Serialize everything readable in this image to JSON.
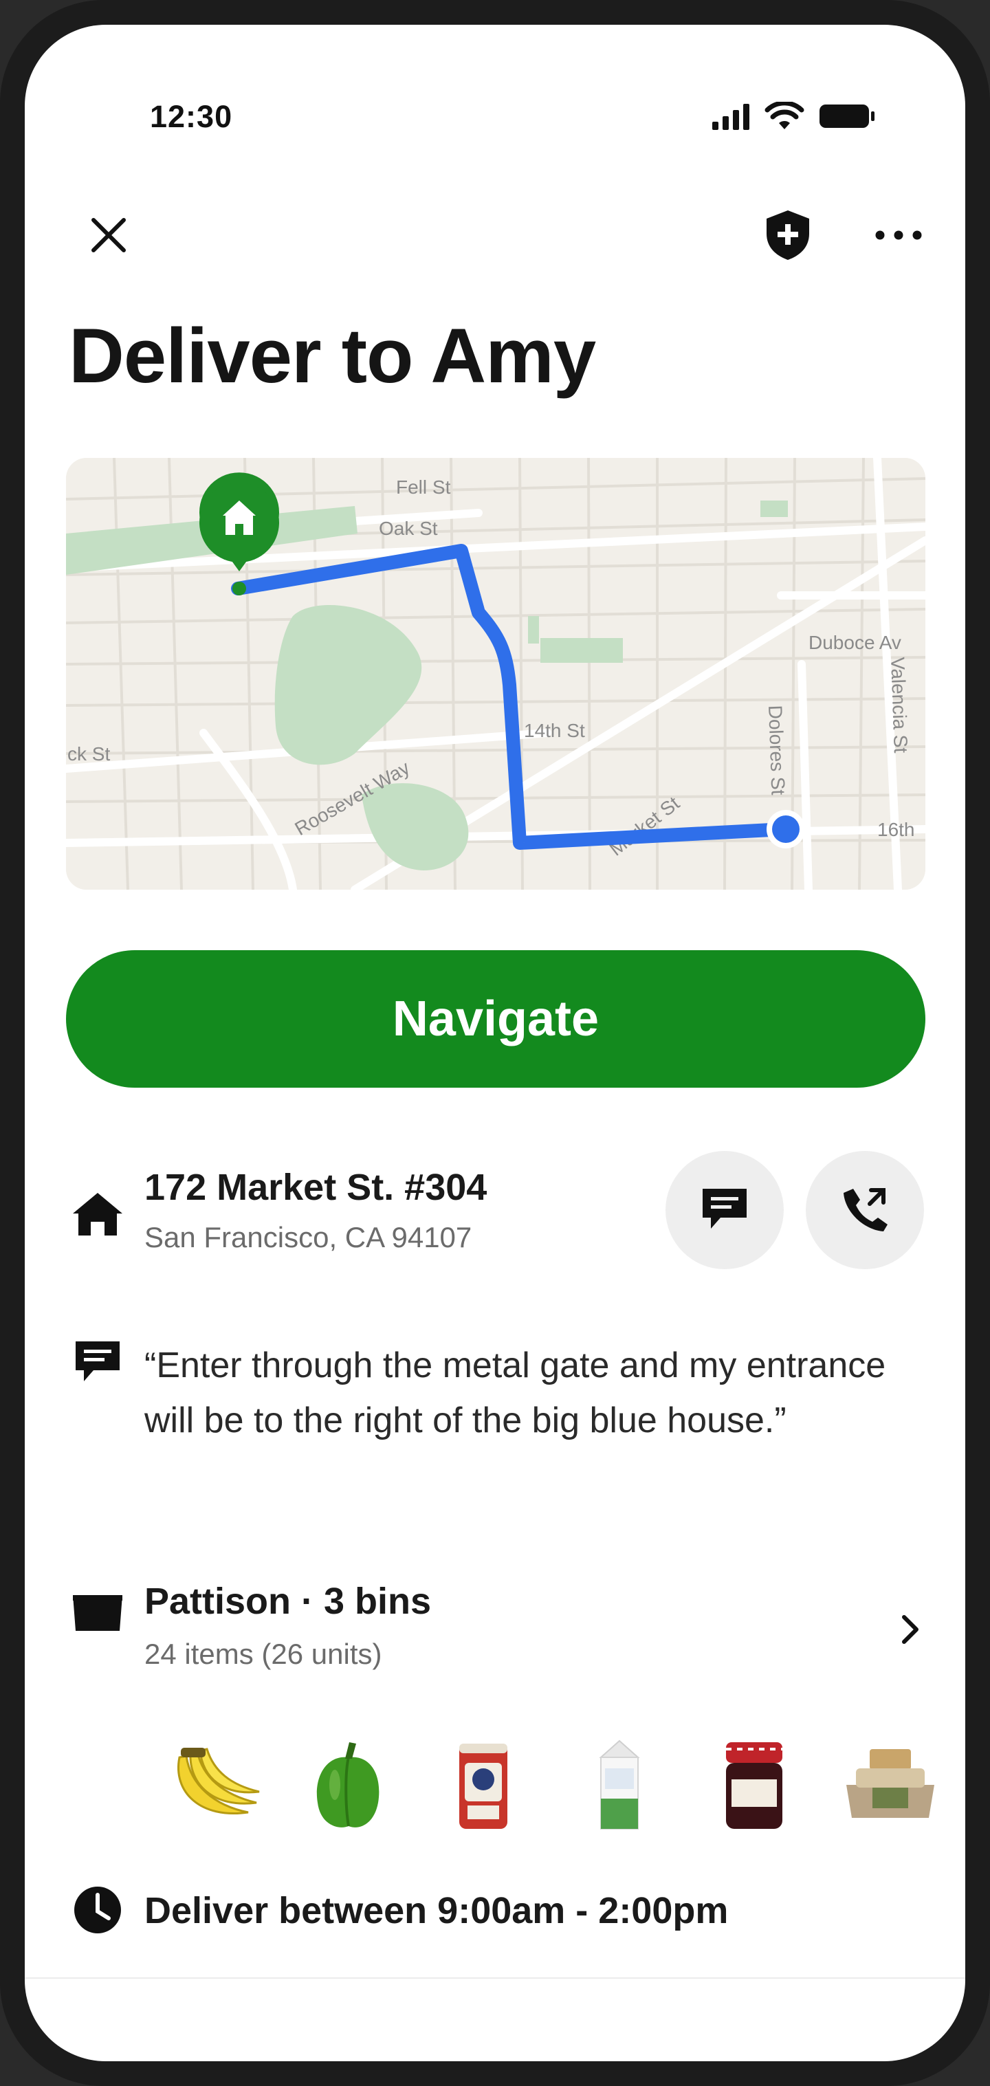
{
  "status_bar": {
    "time": "12:30",
    "icons": [
      "cellular-signal-icon",
      "wifi-icon",
      "battery-icon"
    ]
  },
  "header": {
    "close_icon": "close-icon",
    "safety_icon": "shield-plus-icon",
    "more_icon": "more-horizontal-icon"
  },
  "title": "Deliver to Amy",
  "map": {
    "street_labels": [
      "Fell St",
      "Oak St",
      "Duboce Av",
      "Valencia St",
      "Dolores St",
      "16th",
      "14th St",
      "Roosevelt Way",
      "Market St",
      "ck St"
    ],
    "destination_marker": "home-pin-icon",
    "origin_marker": "current-location-dot",
    "route_color": "#2f6fea",
    "pin_color": "#1e8e28"
  },
  "navigate_label": "Navigate",
  "address": {
    "line1": "172 Market St. #304",
    "line2": "San Francisco, CA 94107",
    "icon": "home-icon",
    "message_icon": "message-icon",
    "call_icon": "phone-icon"
  },
  "note": {
    "icon": "message-icon",
    "text": "“Enter through the metal gate and my entrance will be to the right of the big blue house.”"
  },
  "order": {
    "icon": "bin-icon",
    "title": "Pattison · 3 bins",
    "subtitle": "24 items (26 units)",
    "chevron_icon": "chevron-right-icon",
    "items": [
      "bananas",
      "green-pepper",
      "oats-canister",
      "milk-carton",
      "jam-jar",
      "egg-carton"
    ]
  },
  "delivery_window": {
    "icon": "clock-icon",
    "text": "Deliver between 9:00am - 2:00pm"
  },
  "colors": {
    "accent_green": "#138a1e",
    "map_background": "#f2efe9",
    "map_park": "#c4dfc4"
  }
}
